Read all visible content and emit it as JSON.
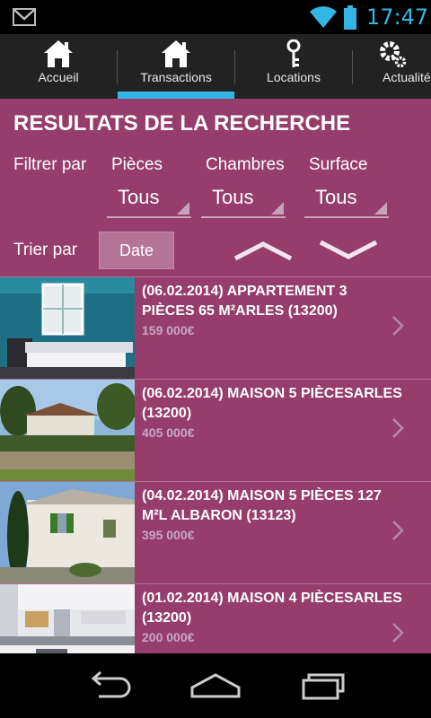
{
  "status_bar": {
    "time": "17:47",
    "icons": [
      "gmail-icon",
      "wifi-icon",
      "battery-icon"
    ],
    "time_color": "#33b5e5"
  },
  "tabs": [
    {
      "label": "Accueil",
      "icon": "home-icon"
    },
    {
      "label": "Transactions",
      "icon": "home-icon",
      "selected": true
    },
    {
      "label": "Locations",
      "icon": "key-icon"
    },
    {
      "label": "Actualités",
      "icon": "gear-icon"
    }
  ],
  "search": {
    "title": "RESULTATS DE LA RECHERCHE",
    "filter_label": "Filtrer par",
    "filters": [
      {
        "label": "Pièces",
        "value": "Tous"
      },
      {
        "label": "Chambres",
        "value": "Tous"
      },
      {
        "label": "Surface",
        "value": "Tous"
      }
    ],
    "sort_label": "Trier par",
    "sort_button": "Date"
  },
  "listings": [
    {
      "title": "(06.02.2014) APPARTEMENT 3 PIÈCES 65 M²ARLES (13200)",
      "price": "159 000€",
      "image": "bedroom-photo"
    },
    {
      "title": "(06.02.2014) MAISON 5 PIÈCESARLES (13200)",
      "price": "405 000€",
      "image": "house-garden-photo"
    },
    {
      "title": "(04.02.2014) MAISON 5 PIÈCES 127 M²L ALBARON (13123)",
      "price": "395 000€",
      "image": "white-house-photo"
    },
    {
      "title": "(01.02.2014) MAISON 4 PIÈCESARLES (13200)",
      "price": "200 000€",
      "image": "kitchen-photo"
    }
  ],
  "colors": {
    "accent": "#33b5e5",
    "background": "#963d6c",
    "tabbar": "#222222",
    "price": "#c5a6c4"
  },
  "nav_bar": [
    "back-icon",
    "home-nav-icon",
    "recent-apps-icon"
  ]
}
